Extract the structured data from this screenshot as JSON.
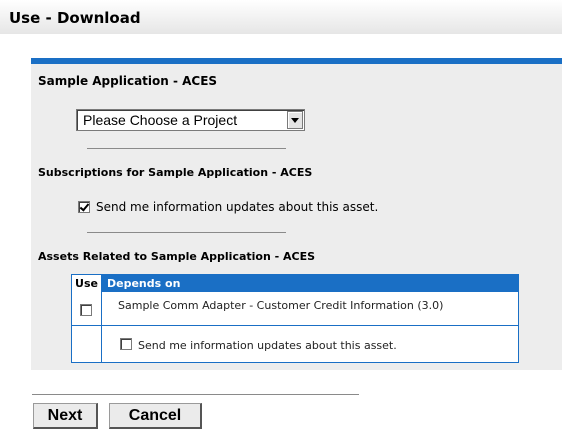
{
  "window": {
    "title": "Use - Download"
  },
  "asset": {
    "heading": "Sample Application - ACES",
    "project_select": {
      "selected": "Please Choose a Project"
    }
  },
  "subscriptions": {
    "heading": "Subscriptions for Sample Application - ACES",
    "checkbox_label": "Send me information updates about this asset.",
    "checked": true
  },
  "related": {
    "heading": "Assets Related to Sample Application - ACES",
    "columns": [
      "Use",
      "Depends on"
    ],
    "rows": [
      {
        "name": "Sample Comm Adapter - Customer Credit Information (3.0)",
        "use_checked": false,
        "subscribe_label": "Send me information updates about this asset.",
        "subscribe_checked": false
      }
    ]
  },
  "buttons": {
    "next": "Next",
    "cancel": "Cancel"
  },
  "colors": {
    "accent": "#1a6fc5",
    "panel_bg": "#ededed"
  }
}
